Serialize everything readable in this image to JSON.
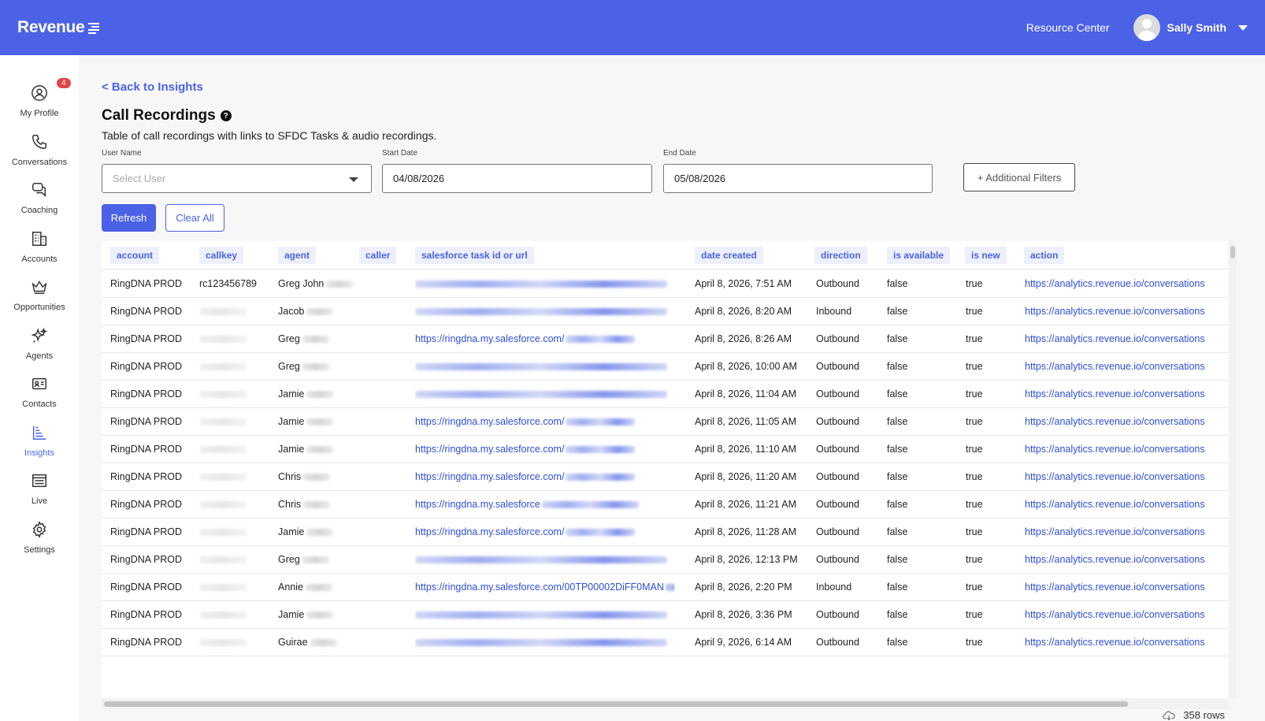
{
  "header": {
    "logo": "Revenue",
    "resource_center": "Resource Center",
    "user_name": "Sally Smith"
  },
  "sidebar": {
    "items": [
      {
        "label": "My Profile",
        "icon": "profile-icon",
        "badge": "4"
      },
      {
        "label": "Conversations",
        "icon": "phone-icon"
      },
      {
        "label": "Coaching",
        "icon": "chat-icon"
      },
      {
        "label": "Accounts",
        "icon": "building-icon"
      },
      {
        "label": "Opportunities",
        "icon": "crown-icon"
      },
      {
        "label": "Agents",
        "icon": "sparkle-icon"
      },
      {
        "label": "Contacts",
        "icon": "contact-card-icon"
      },
      {
        "label": "Insights",
        "icon": "bar-chart-icon",
        "active": true
      },
      {
        "label": "Live",
        "icon": "list-icon"
      },
      {
        "label": "Settings",
        "icon": "gear-icon"
      }
    ]
  },
  "page": {
    "back_link": "< Back to Insights",
    "title": "Call Recordings",
    "subtitle": "Table of call recordings with links to SFDC Tasks & audio recordings."
  },
  "filters": {
    "user_name_label": "User Name",
    "user_name_placeholder": "Select User",
    "start_date_label": "Start Date",
    "start_date_value": "04/08/2026",
    "end_date_label": "End Date",
    "end_date_value": "05/08/2026",
    "additional_filters": "+ Additional Filters",
    "refresh": "Refresh",
    "clear_all": "Clear All"
  },
  "table": {
    "columns": [
      "account",
      "callkey",
      "agent",
      "caller",
      "salesforce task id or url",
      "date created",
      "direction",
      "is available",
      "is new",
      "action"
    ],
    "rows": [
      {
        "account": "RingDNA PROD",
        "callkey": "rc123456789",
        "agent": "Greg John",
        "date": "April 8, 2026, 7:51 AM",
        "direction": "Outbound",
        "available": "false",
        "new": "true",
        "action": "https://analytics.revenue.io/conversations"
      },
      {
        "account": "RingDNA PROD",
        "callkey": "",
        "agent": "Jacob",
        "date": "April 8, 2026, 8:20 AM",
        "direction": "Inbound",
        "available": "false",
        "new": "true",
        "action": "https://analytics.revenue.io/conversations"
      },
      {
        "account": "RingDNA PROD",
        "callkey": "",
        "agent": "Greg",
        "sf": "https://ringdna.my.salesforce.com/",
        "date": "April 8, 2026, 8:26 AM",
        "direction": "Outbound",
        "available": "false",
        "new": "true",
        "action": "https://analytics.revenue.io/conversations"
      },
      {
        "account": "RingDNA PROD",
        "callkey": "",
        "agent": "Greg",
        "date": "April 8, 2026, 10:00 AM",
        "direction": "Outbound",
        "available": "false",
        "new": "true",
        "action": "https://analytics.revenue.io/conversations"
      },
      {
        "account": "RingDNA PROD",
        "callkey": "",
        "agent": "Jamie",
        "date": "April 8, 2026, 11:04 AM",
        "direction": "Outbound",
        "available": "false",
        "new": "true",
        "action": "https://analytics.revenue.io/conversations"
      },
      {
        "account": "RingDNA PROD",
        "callkey": "",
        "agent": "Jamie",
        "sf": "https://ringdna.my.salesforce.com/",
        "date": "April 8, 2026, 11:05 AM",
        "direction": "Outbound",
        "available": "false",
        "new": "true",
        "action": "https://analytics.revenue.io/conversations"
      },
      {
        "account": "RingDNA PROD",
        "callkey": "",
        "agent": "Jamie",
        "sf": "https://ringdna.my.salesforce.com/",
        "date": "April 8, 2026, 11:10 AM",
        "direction": "Outbound",
        "available": "false",
        "new": "true",
        "action": "https://analytics.revenue.io/conversations"
      },
      {
        "account": "RingDNA PROD",
        "callkey": "",
        "agent": "Chris",
        "sf": "https://ringdna.my.salesforce.com/",
        "date": "April 8, 2026, 11:20 AM",
        "direction": "Outbound",
        "available": "false",
        "new": "true",
        "action": "https://analytics.revenue.io/conversations"
      },
      {
        "account": "RingDNA PROD",
        "callkey": "",
        "agent": "Chris",
        "sf": "https://ringdna.my.salesforce",
        "date": "April 8, 2026, 11:21 AM",
        "direction": "Outbound",
        "available": "false",
        "new": "true",
        "action": "https://analytics.revenue.io/conversations"
      },
      {
        "account": "RingDNA PROD",
        "callkey": "",
        "agent": "Jamie",
        "sf": "https://ringdna.my.salesforce.com/",
        "date": "April 8, 2026, 11:28 AM",
        "direction": "Outbound",
        "available": "false",
        "new": "true",
        "action": "https://analytics.revenue.io/conversations"
      },
      {
        "account": "RingDNA PROD",
        "callkey": "",
        "agent": "Greg",
        "date": "April 8, 2026, 12:13 PM",
        "direction": "Outbound",
        "available": "false",
        "new": "true",
        "action": "https://analytics.revenue.io/conversations"
      },
      {
        "account": "RingDNA PROD",
        "callkey": "",
        "agent": "Annie",
        "sf": "https://ringdna.my.salesforce.com/00TP00002DiFF0MAN",
        "date": "April 8, 2026, 2:20 PM",
        "direction": "Inbound",
        "available": "false",
        "new": "true",
        "action": "https://analytics.revenue.io/conversations"
      },
      {
        "account": "RingDNA PROD",
        "callkey": "",
        "agent": "Jamie",
        "date": "April 8, 2026, 3:36 PM",
        "direction": "Outbound",
        "available": "false",
        "new": "true",
        "action": "https://analytics.revenue.io/conversations"
      },
      {
        "account": "RingDNA PROD",
        "callkey": "",
        "agent": "Guirae",
        "date": "April 9, 2026, 6:14 AM",
        "direction": "Outbound",
        "available": "false",
        "new": "true",
        "action": "https://analytics.revenue.io/conversations"
      }
    ]
  },
  "footer": {
    "row_count": "358 rows"
  },
  "colors": {
    "brand": "#4b62e6",
    "link": "#2f4ed8",
    "badge": "#e2444a"
  }
}
